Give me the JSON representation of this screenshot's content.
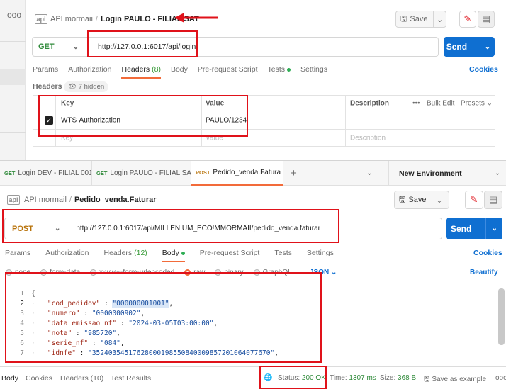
{
  "top": {
    "breadcrumb": {
      "parent": "API mormaii",
      "current": "Login PAULO - FILIAL SAT"
    },
    "save_label": "Save",
    "method": "GET",
    "url": "http://127.0.0.1:6017/api/login",
    "send_label": "Send",
    "tabs": [
      {
        "label": "Params"
      },
      {
        "label": "Authorization"
      },
      {
        "label": "Headers",
        "count": "(8)"
      },
      {
        "label": "Body"
      },
      {
        "label": "Pre-request Script"
      },
      {
        "label": "Tests"
      },
      {
        "label": "Settings"
      }
    ],
    "cookies_label": "Cookies",
    "headers_label": "Headers",
    "hidden_label": "7 hidden",
    "table": {
      "col_key": "Key",
      "col_value": "Value",
      "col_description": "Description",
      "bulk_edit": "Bulk Edit",
      "presets": "Presets",
      "row_key": "WTS-Authorization",
      "row_value": "PAULO/1234",
      "ph_key": "Key",
      "ph_value": "Value",
      "ph_description": "Description"
    }
  },
  "bottom": {
    "request_tabs": [
      {
        "method": "GET",
        "label": "Login DEV - FILIAL 001"
      },
      {
        "method": "GET",
        "label": "Login PAULO - FILIAL SAT"
      },
      {
        "method": "POST",
        "label": "Pedido_venda.Fatura"
      }
    ],
    "environment": "New Environment",
    "breadcrumb": {
      "parent": "API mormail",
      "current": "Pedido_venda.Faturar"
    },
    "save_label": "Save",
    "method": "POST",
    "url": "http://127.0.0.1:6017/api/MILLENIUM_ECO!MMORMAII/pedido_venda.faturar",
    "send_label": "Send",
    "tabs": [
      {
        "label": "Params"
      },
      {
        "label": "Authorization"
      },
      {
        "label": "Headers",
        "count": "(12)"
      },
      {
        "label": "Body"
      },
      {
        "label": "Pre-request Script"
      },
      {
        "label": "Tests"
      },
      {
        "label": "Settings"
      }
    ],
    "cookies_label": "Cookies",
    "body_types": [
      "none",
      "form-data",
      "x-www-form-urlencoded",
      "raw",
      "binary",
      "GraphQL"
    ],
    "body_format": "JSON",
    "beautify_label": "Beautify",
    "code_lines": [
      {
        "n": "1",
        "key": "",
        "val": "",
        "text": "{"
      },
      {
        "n": "2",
        "key": "\"cod_pedidov\"",
        "val": "\"000000001001\""
      },
      {
        "n": "3",
        "key": "\"numero\"",
        "val": "\"0000000902\""
      },
      {
        "n": "4",
        "key": "\"data_emissao_nf\"",
        "val": "\"2024-03-05T03:00:00\""
      },
      {
        "n": "5",
        "key": "\"nota\"",
        "val": "\"985720\""
      },
      {
        "n": "6",
        "key": "\"serie_nf\"",
        "val": "\"084\""
      },
      {
        "n": "7",
        "key": "\"idnfe\"",
        "val": "\"35240354517628000198550840009857201064077670\""
      }
    ],
    "response_tabs": [
      "Body",
      "Cookies",
      "Headers (10)",
      "Test Results"
    ],
    "status_label": "Status:",
    "status_value": "200 OK",
    "time_label": "Time:",
    "time_value": "1307 ms",
    "size_label": "Size:",
    "size_value": "368 B",
    "save_example_label": "Save as example"
  },
  "colors": {
    "accent_send": "#0f6fd1",
    "annotation_red": "#e0121a",
    "active_tab_orange": "#f26b3a"
  }
}
